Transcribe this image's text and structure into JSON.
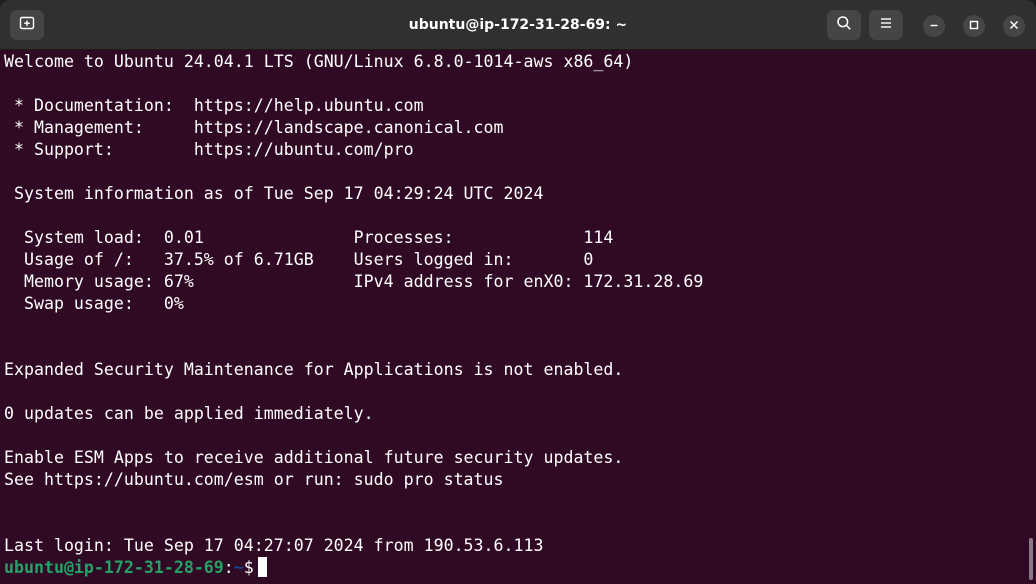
{
  "window": {
    "title": "ubuntu@ip-172-31-28-69: ~"
  },
  "icons": {
    "new_tab": "new-tab-icon",
    "search": "search-icon",
    "menu": "hamburger-menu-icon",
    "minimize": "minimize-icon",
    "maximize": "maximize-icon",
    "close": "close-icon"
  },
  "colors": {
    "terminal_bg": "#300a24",
    "titlebar_bg": "#303030",
    "prompt_user": "#26a269",
    "prompt_path": "#12488b",
    "text": "#ffffff"
  },
  "terminal": {
    "welcome": "Welcome to Ubuntu 24.04.1 LTS (GNU/Linux 6.8.0-1014-aws x86_64)",
    "doc": " * Documentation:  https://help.ubuntu.com",
    "mgmt": " * Management:     https://landscape.canonical.com",
    "support": " * Support:        https://ubuntu.com/pro",
    "sysinfo": " System information as of Tue Sep 17 04:29:24 UTC 2024",
    "stats1": "  System load:  0.01               Processes:             114",
    "stats2": "  Usage of /:   37.5% of 6.71GB    Users logged in:       0",
    "stats3": "  Memory usage: 67%                IPv4 address for enX0: 172.31.28.69",
    "stats4": "  Swap usage:   0%",
    "esm": "Expanded Security Maintenance for Applications is not enabled.",
    "updates": "0 updates can be applied immediately.",
    "enable_esm": "Enable ESM Apps to receive additional future security updates.",
    "see_esm": "See https://ubuntu.com/esm or run: sudo pro status",
    "last_login": "Last login: Tue Sep 17 04:27:07 2024 from 190.53.6.113",
    "prompt_user": "ubuntu@ip-172-31-28-69",
    "prompt_sep": ":",
    "prompt_path": "~",
    "prompt_symbol": "$"
  }
}
